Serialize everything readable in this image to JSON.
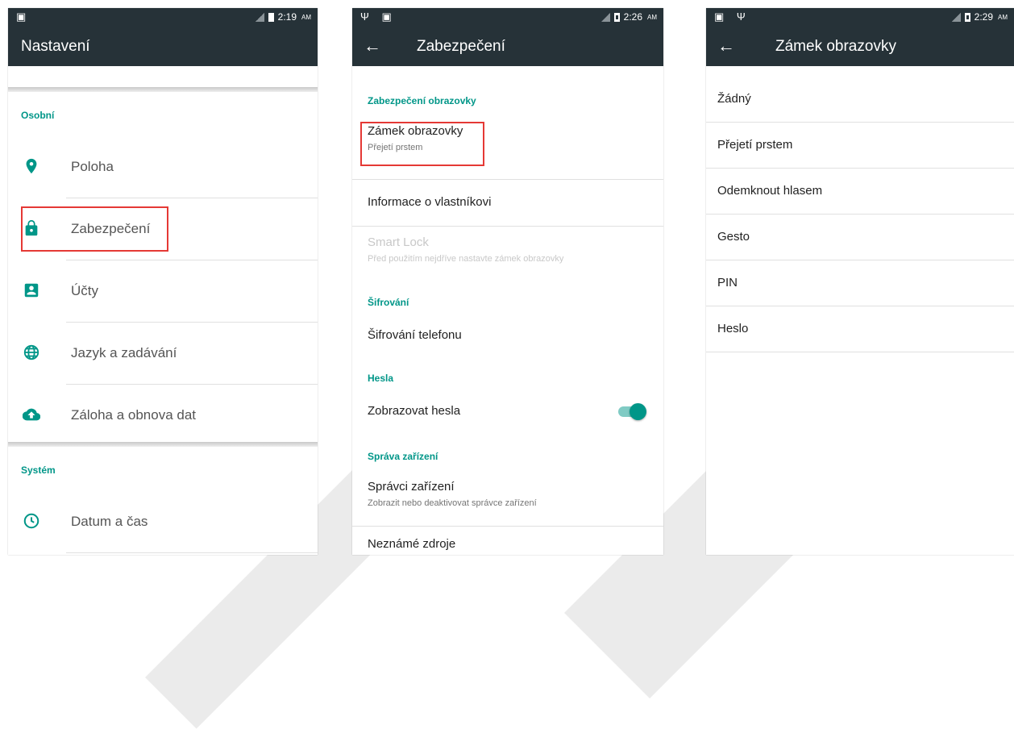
{
  "colors": {
    "accent": "#009688",
    "appbar": "#263238",
    "highlight": "#e53935"
  },
  "screen1": {
    "status": {
      "icons": "▣",
      "time": "2:19",
      "ampm": "AM"
    },
    "title": "Nastavení",
    "sections": [
      {
        "header": "Osobní",
        "items": [
          {
            "label": "Poloha",
            "icon": "location-pin-icon"
          },
          {
            "label": "Zabezpečení",
            "icon": "lock-icon",
            "highlighted": true
          },
          {
            "label": "Účty",
            "icon": "account-box-icon"
          },
          {
            "label": "Jazyk a zadávání",
            "icon": "globe-icon"
          },
          {
            "label": "Záloha a obnova dat",
            "icon": "cloud-upload-icon"
          }
        ]
      },
      {
        "header": "Systém",
        "items": [
          {
            "label": "Datum a čas",
            "icon": "clock-icon"
          }
        ]
      }
    ]
  },
  "screen2": {
    "status": {
      "icons": "Ψ ▣",
      "time": "2:26",
      "ampm": "AM"
    },
    "title": "Zabezpečení",
    "sections": [
      {
        "header": "Zabezpečení obrazovky",
        "items": [
          {
            "title": "Zámek obrazovky",
            "summary": "Přejetí prstem",
            "highlighted": true
          },
          {
            "title": "Informace o vlastníkovi"
          },
          {
            "title": "Smart Lock",
            "summary": "Před použitím nejdříve nastavte zámek obrazovky",
            "disabled": true
          }
        ]
      },
      {
        "header": "Šifrování",
        "items": [
          {
            "title": "Šifrování telefonu"
          }
        ]
      },
      {
        "header": "Hesla",
        "items": [
          {
            "title": "Zobrazovat hesla",
            "toggle": true
          }
        ]
      },
      {
        "header": "Správa zařízení",
        "items": [
          {
            "title": "Správci zařízení",
            "summary": "Zobrazit nebo deaktivovat správce zařízení"
          },
          {
            "title": "Neznámé zdroje"
          }
        ]
      }
    ]
  },
  "screen3": {
    "status": {
      "icons": "▣ Ψ",
      "time": "2:29",
      "ampm": "AM"
    },
    "title": "Zámek obrazovky",
    "items": [
      "Žádný",
      "Přejetí prstem",
      "Odemknout hlasem",
      "Gesto",
      "PIN",
      "Heslo"
    ]
  }
}
